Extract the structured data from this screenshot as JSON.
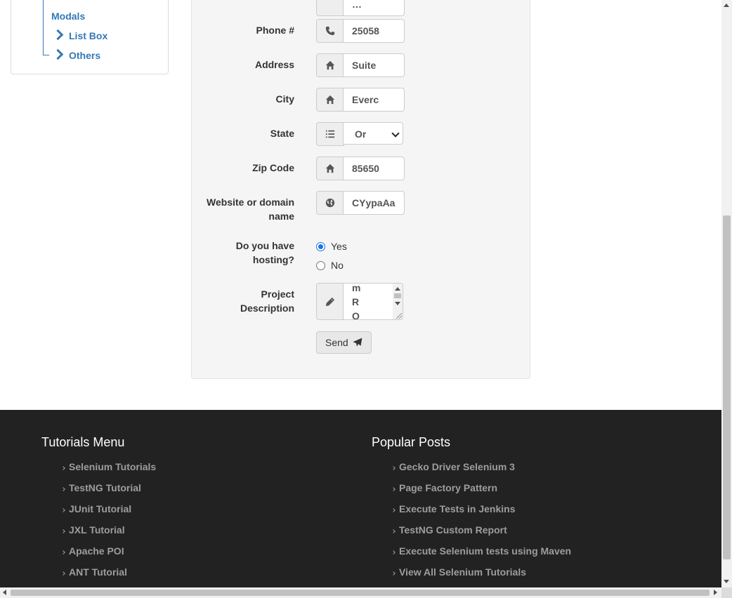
{
  "sidebar": {
    "modals_label": "Modals",
    "items": [
      {
        "label": "List Box"
      },
      {
        "label": "Others"
      }
    ]
  },
  "form": {
    "fields": {
      "phone": {
        "label": "Phone #",
        "value": "25058",
        "icon": "phone-icon"
      },
      "address": {
        "label": "Address",
        "value": "Suite",
        "icon": "home-icon"
      },
      "city": {
        "label": "City",
        "value": "Everc",
        "icon": "home-icon"
      },
      "state": {
        "label": "State",
        "selected": "Or",
        "icon": "list-icon"
      },
      "zip": {
        "label": "Zip Code",
        "value": "85650",
        "icon": "home-icon"
      },
      "website": {
        "label_line1": "Website or domain",
        "label_line2": "name",
        "value": "CYypaAa",
        "icon": "globe-icon"
      }
    },
    "hosting": {
      "label_line1": "Do you have",
      "label_line2": "hosting?",
      "options": [
        {
          "label": "Yes",
          "checked": true
        },
        {
          "label": "No",
          "checked": false
        }
      ]
    },
    "description": {
      "label_line1": "Project",
      "label_line2": "Description",
      "lines": [
        "m",
        "R",
        "Q"
      ],
      "icon": "pencil-icon"
    },
    "send_label": "Send"
  },
  "footer": {
    "tutorials_title": "Tutorials Menu",
    "tutorials": [
      "Selenium Tutorials",
      "TestNG Tutorial",
      "JUnit Tutorial",
      "JXL Tutorial",
      "Apache POI",
      "ANT Tutorial"
    ],
    "posts_title": "Popular Posts",
    "posts": [
      "Gecko Driver Selenium 3",
      "Page Factory Pattern",
      "Execute Tests in Jenkins",
      "TestNG Custom Report",
      "Execute Selenium tests using Maven",
      "View All Selenium Tutorials"
    ]
  }
}
